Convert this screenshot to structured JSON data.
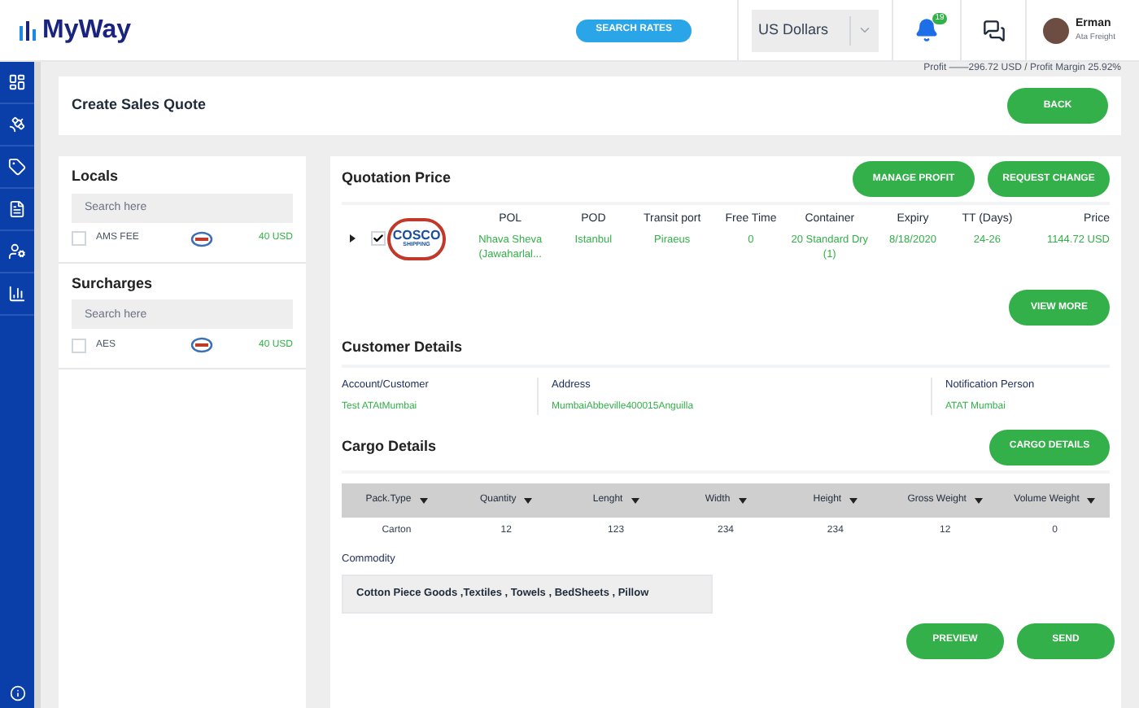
{
  "header": {
    "logo": "MyWay",
    "search_button": "SEARCH RATES",
    "currency": "US Dollars",
    "notification_count": "19",
    "user": {
      "name": "Erman",
      "company": "Ata Freight"
    }
  },
  "profit_summary": "Profit ——296.72 USD / Profit Margin 25.92%",
  "page_title": "Create Sales Quote",
  "back_button": "BACK",
  "charge_groups": [
    {
      "title": "Locals",
      "search_placeholder": "Search here",
      "items": [
        {
          "label": "AMS FEE",
          "checked": false,
          "price": "40 USD"
        }
      ]
    },
    {
      "title": "Surcharges",
      "search_placeholder": "Search here",
      "items": [
        {
          "label": "AES",
          "checked": false,
          "price": "40 USD"
        }
      ]
    }
  ],
  "quotation": {
    "title": "Quotation Price",
    "buttons": [
      "MANAGE PROFIT",
      "REQUEST CHANGE"
    ],
    "columns": [
      "POL",
      "POD",
      "Transit port",
      "Free Time",
      "Container",
      "Expiry",
      "TT (Days)",
      "Price"
    ],
    "rows": [
      {
        "expanded": false,
        "checked": true,
        "carrier": {
          "name": "COSCO",
          "sub": "SHIPPING"
        },
        "cells": [
          "Nhava Sheva (Jawaharlal...",
          "Istanbul",
          "Piraeus",
          "0",
          "20 Standard Dry (1)",
          "8/18/2020",
          "24-26",
          "1144.72 USD"
        ]
      }
    ],
    "view_more": "VIEW MORE"
  },
  "customer": {
    "title": "Customer Details",
    "fields": [
      {
        "label": "Account/Customer",
        "value": "Test ATAtMumbai"
      },
      {
        "label": "Address",
        "value": "MumbaiAbbeville400015Anguilla"
      },
      {
        "label": "Notification Person",
        "value": "ATAT Mumbai"
      }
    ]
  },
  "cargo": {
    "title": "Cargo Details",
    "button": "CARGO DETAILS",
    "columns": [
      "Pack.Type",
      "Quantity",
      "Lenght",
      "Width",
      "Height",
      "Gross Weight",
      "Volume Weight"
    ],
    "rows": [
      [
        "Carton",
        "12",
        "123",
        "234",
        "234",
        "12",
        "0"
      ]
    ],
    "commodity_label": "Commodity",
    "commodity_value": "Cotton Piece Goods ,Textiles , Towels , BedSheets , Pillow"
  },
  "actions": [
    "PREVIEW",
    "SEND"
  ]
}
